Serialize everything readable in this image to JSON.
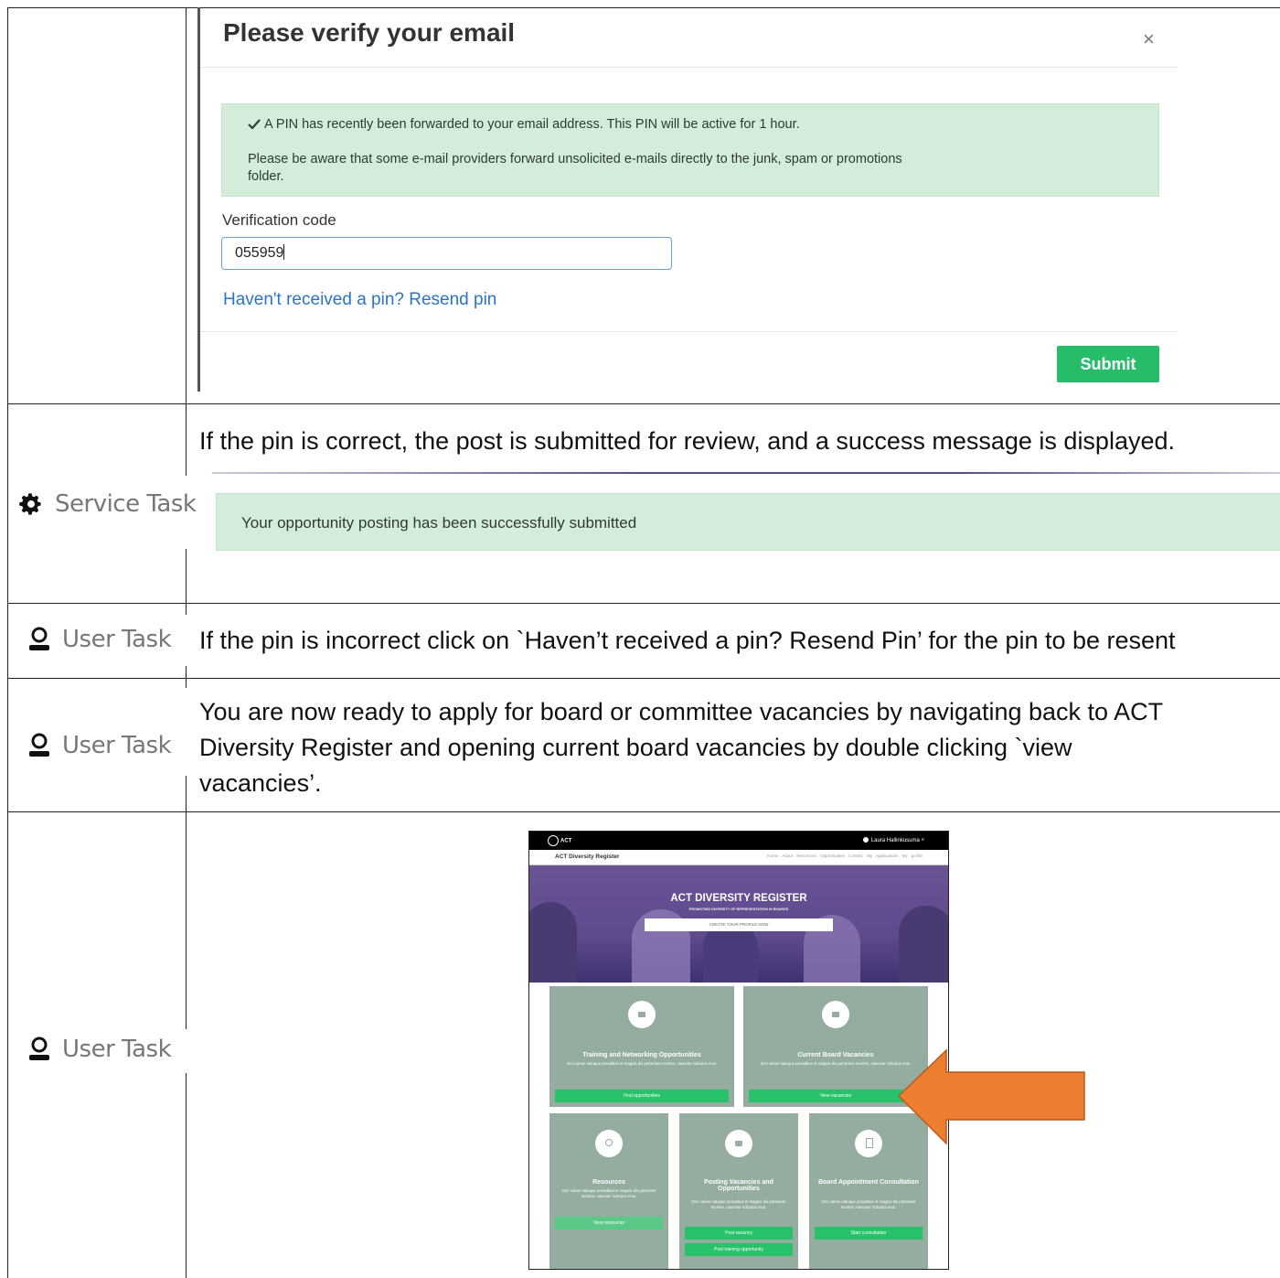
{
  "modal": {
    "title": "Please verify your email",
    "close": "×",
    "alert_line1": "A PIN has recently been forwarded to your email address. This PIN will be active for 1 hour.",
    "alert_line2": "Please be aware that some e-mail providers forward unsolicited e-mails directly to the junk, spam or promotions",
    "alert_line3": "folder.",
    "field_label": "Verification code",
    "field_value": "055959",
    "resend_link": "Haven't received a pin? Resend pin",
    "submit_label": "Submit"
  },
  "rows": [
    {
      "task": "Service Task",
      "text": "If the pin is correct, the post is submitted for review, and a success message is displayed.",
      "success_message": "Your opportunity posting has been successfully submitted"
    },
    {
      "task": "User Task",
      "text": "If the pin is incorrect click on `Haven’t received a pin? Resend Pin’ for the pin to be resent"
    },
    {
      "task": "User Task",
      "text_line1": "You are now ready to apply for board or committee vacancies by navigating back to ACT",
      "text_line2": "Diversity Register and opening current board vacancies by double clicking `view",
      "text_line3": "vacancies’."
    },
    {
      "task": "User Task"
    }
  ],
  "screenshot": {
    "logo": "ACT",
    "user": "Laura Hallinkusuma ˅",
    "site_name": "ACT Diversity Register",
    "nav": [
      "Home",
      "About",
      "Resources",
      "Opportunities",
      "Contact",
      "My Applications",
      "My profile"
    ],
    "hero_title": "ACT DIVERSITY REGISTER",
    "hero_sub": "PROMOTING DIVERSITY OF REPRESENTATION IN BOARDS",
    "hero_button": "CREATE YOUR PROFILE NOW",
    "cards": [
      {
        "title": "Training and Networking Opportunities",
        "desc": "Orci varius natoque penatibus et magnis dis parturient montes, nascetur ridiculus mus.",
        "button": "Find opportunities"
      },
      {
        "title": "Current Board Vacancies",
        "desc": "Orci varius natoque penatibus et magnis dis parturient montes, nascetur ridiculus mus.",
        "button": "View vacancies"
      },
      {
        "title": "Resources",
        "desc": "Orci varius natoque penatibus et magnis dis parturient montes, nascetur ridiculus mus.",
        "button": "View resources"
      },
      {
        "title": "Posting Vacancies and Opportunities",
        "desc": "Orci varius natoque penatibus et magnis dis parturient montes, nascetur ridiculus mus.",
        "button": "Post vacancy",
        "button2": "Post training opportunity"
      },
      {
        "title": "Board Appointment Consultation",
        "desc": "Orci varius natoque penatibus et magnis dis parturient montes, nascetur ridiculus mus.",
        "button": "Start consultation"
      }
    ]
  },
  "colors": {
    "success_bg": "#d4eddb",
    "submit_green": "#27bc67",
    "link_blue": "#2a73c9",
    "arrow_orange": "#ed7d31",
    "card_green": "#94ad9f",
    "hero_purple": "#5e4a8d"
  }
}
